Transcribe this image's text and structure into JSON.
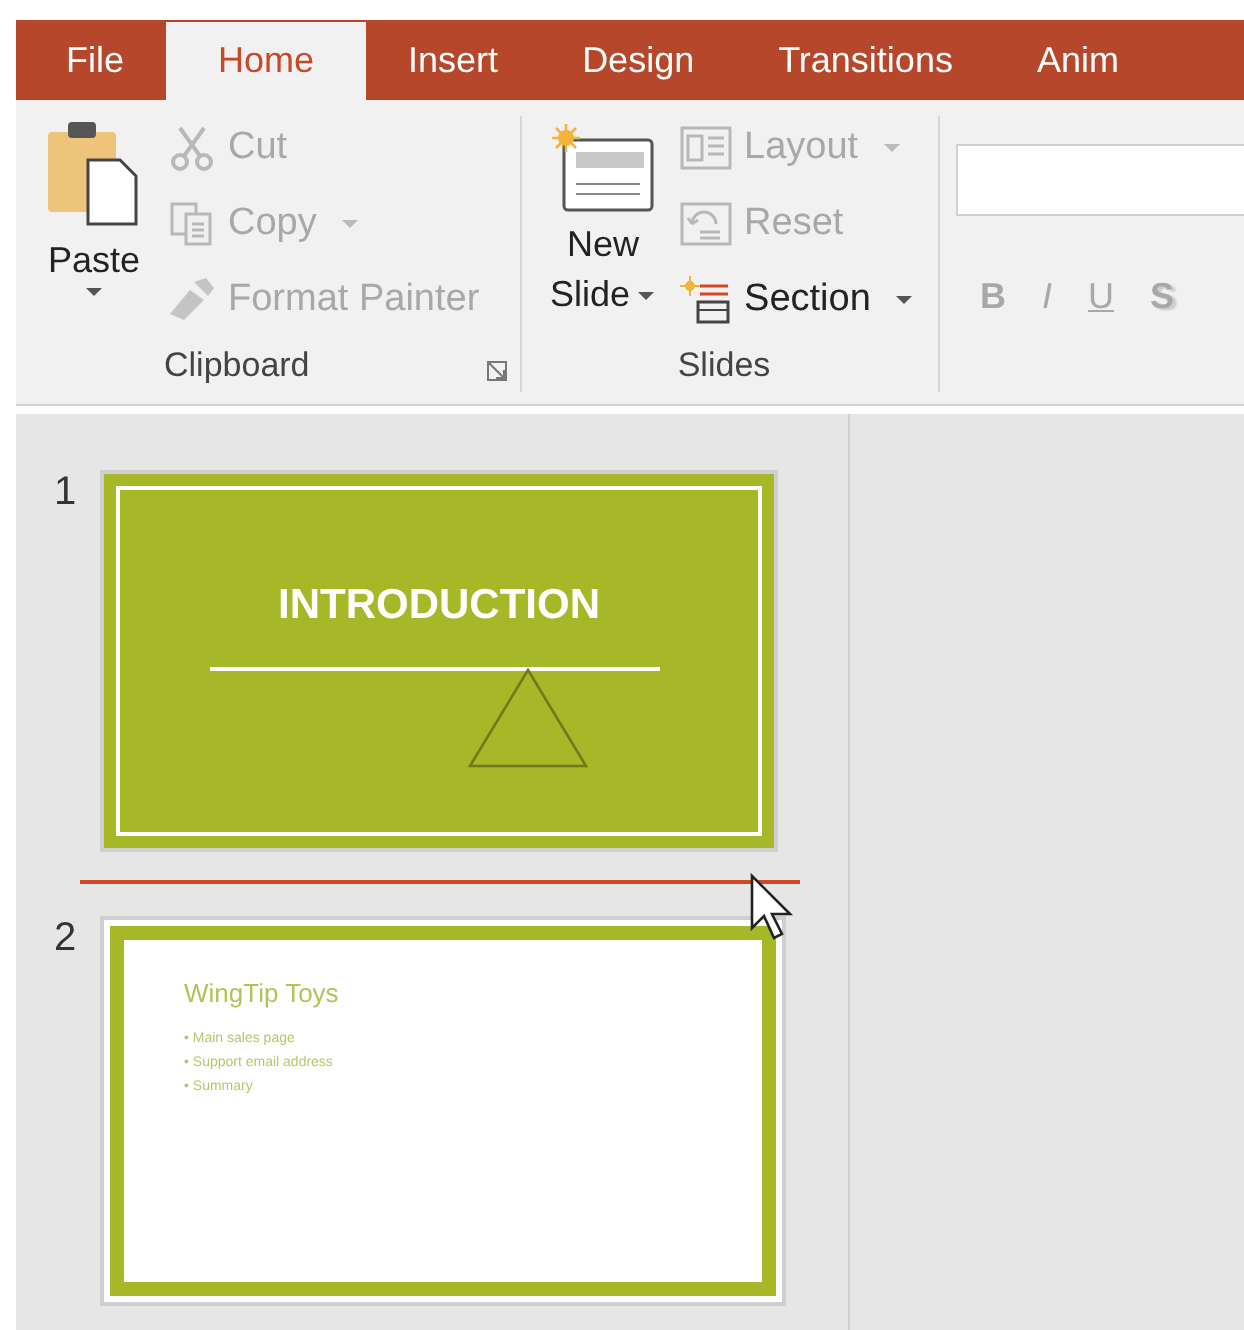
{
  "tabs": [
    {
      "label": "File",
      "selected": false
    },
    {
      "label": "Home",
      "selected": true
    },
    {
      "label": "Insert",
      "selected": false
    },
    {
      "label": "Design",
      "selected": false
    },
    {
      "label": "Transitions",
      "selected": false
    },
    {
      "label": "Anim",
      "selected": false
    }
  ],
  "clipboard": {
    "label": "Clipboard",
    "paste": {
      "label": "Paste",
      "disabled": false
    },
    "items": [
      {
        "kind": "cut",
        "label": "Cut",
        "disabled": true,
        "dropdown": false
      },
      {
        "kind": "copy",
        "label": "Copy",
        "disabled": true,
        "dropdown": true
      },
      {
        "kind": "painter",
        "label": "Format Painter",
        "disabled": true,
        "dropdown": false
      }
    ]
  },
  "slides_group": {
    "label": "Slides",
    "new_slide": {
      "label_1": "New",
      "label_2": "Slide",
      "disabled": false
    },
    "items": [
      {
        "kind": "layout",
        "label": "Layout",
        "disabled": true,
        "dropdown": true
      },
      {
        "kind": "reset",
        "label": "Reset",
        "disabled": true,
        "dropdown": false
      },
      {
        "kind": "section",
        "label": "Section",
        "disabled": false,
        "dropdown": true
      }
    ]
  },
  "font_group": {
    "buttons": [
      {
        "label": "B",
        "kind": "bold",
        "disabled": true
      },
      {
        "label": "I",
        "kind": "italic",
        "disabled": true
      },
      {
        "label": "U",
        "kind": "underline",
        "disabled": true
      },
      {
        "label": "S",
        "kind": "shadow",
        "disabled": true
      }
    ]
  },
  "slides": [
    {
      "number": "1",
      "kind": "title",
      "title": "INTRODUCTION"
    },
    {
      "number": "2",
      "kind": "content",
      "title": "WingTip Toys",
      "bullets": [
        "• Main sales page",
        "• Support email address",
        "• Summary"
      ]
    }
  ]
}
